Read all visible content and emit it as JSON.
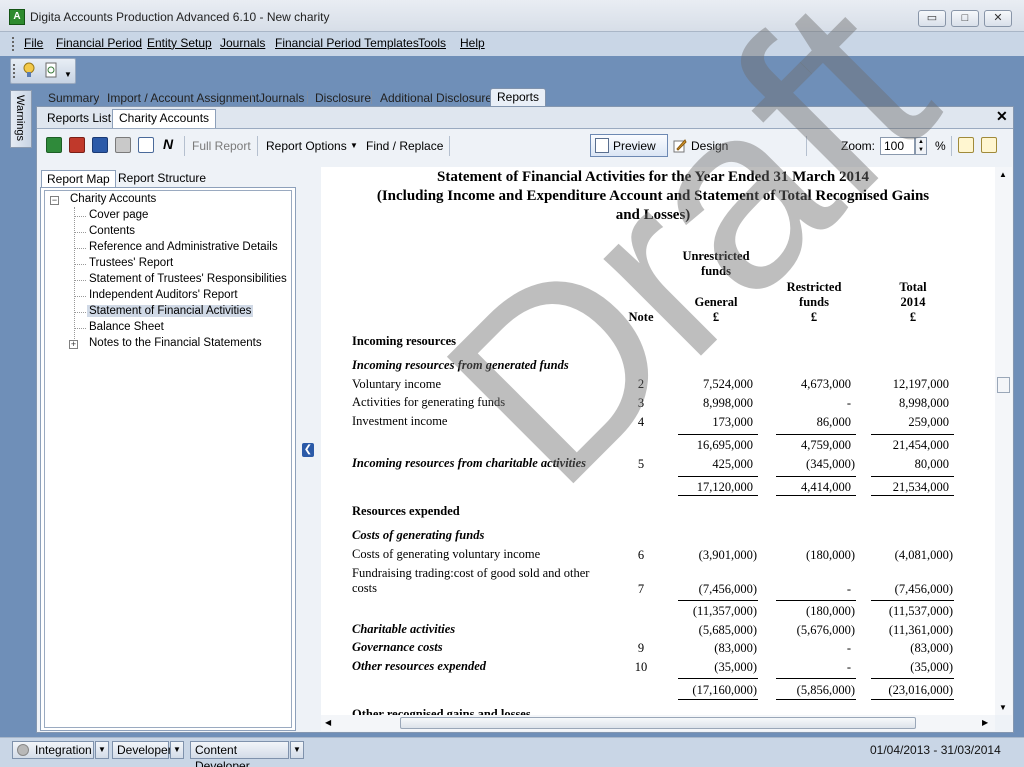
{
  "window": {
    "title": "Digita Accounts Production Advanced 6.10 - New charity",
    "app_icon": "A",
    "minimize": "▭",
    "maximize": "□",
    "close": "✕"
  },
  "menu": [
    "File",
    "Financial Period",
    "Entity Setup",
    "Journals",
    "Financial Period Templates",
    "Tools",
    "Help"
  ],
  "warnings_tab": "Warnings",
  "main_tabs": [
    "Summary",
    "Import / Account Assignment",
    "Journals",
    "Disclosure",
    "Additional Disclosures",
    "Reports"
  ],
  "sub_tabs": [
    "Reports List",
    "Charity Accounts"
  ],
  "toolbar": {
    "full_report": "Full Report",
    "report_options": "Report Options",
    "find_replace": "Find / Replace",
    "preview": "Preview",
    "design": "Design",
    "zoom_label": "Zoom:",
    "zoom_value": "100",
    "zoom_unit": "%",
    "n_label": "N"
  },
  "left_tabs": [
    "Report Map",
    "Report Structure"
  ],
  "tree": {
    "root": "Charity Accounts",
    "items": [
      "Cover page",
      "Contents",
      "Reference and Administrative Details",
      "Trustees' Report",
      "Statement of Trustees' Responsibilities",
      "Independent Auditors' Report",
      "Statement of Financial Activities",
      "Balance Sheet",
      "Notes to the Financial Statements"
    ],
    "selected": "Statement of Financial Activities"
  },
  "report": {
    "title_line1": "Statement of Financial Activities for the Year Ended 31 March 2014",
    "title_line2": "(Including Income and Expenditure Account and Statement of Total Recognised Gains",
    "title_line3": "and Losses)",
    "headers": {
      "unrestricted": "Unrestricted",
      "funds": "funds",
      "general": "General",
      "restricted": "Restricted",
      "restricted_funds": "funds",
      "total": "Total",
      "year": "2014",
      "note": "Note",
      "currency": "£"
    },
    "section_incoming": "Incoming resources",
    "sub_generated": "Incoming resources from generated funds",
    "rows_generated": [
      {
        "label": "Voluntary income",
        "note": "2",
        "general": "7,524,000",
        "restricted": "4,673,000",
        "total": "12,197,000"
      },
      {
        "label": "Activities for generating funds",
        "note": "3",
        "general": "8,998,000",
        "restricted": "-",
        "total": "8,998,000"
      },
      {
        "label": "Investment income",
        "note": "4",
        "general": "173,000",
        "restricted": "86,000",
        "total": "259,000"
      }
    ],
    "subtotal_generated": {
      "general": "16,695,000",
      "restricted": "4,759,000",
      "total": "21,454,000"
    },
    "charitable_income": {
      "label": "Incoming resources from charitable activities",
      "note": "5",
      "general": "425,000",
      "restricted": "(345,000)",
      "total": "80,000"
    },
    "total_incoming": {
      "general": "17,120,000",
      "restricted": "4,414,000",
      "total": "21,534,000"
    },
    "section_expended": "Resources expended",
    "sub_costs": "Costs of generating funds",
    "rows_costs": [
      {
        "label": "Costs of generating voluntary income",
        "note": "6",
        "general": "(3,901,000)",
        "restricted": "(180,000)",
        "total": "(4,081,000)"
      },
      {
        "label_line1": "Fundraising trading:cost of good sold and other",
        "label_line2": "costs",
        "note": "7",
        "general": "(7,456,000)",
        "restricted": "-",
        "total": "(7,456,000)"
      }
    ],
    "subtotal_costs": {
      "general": "(11,357,000)",
      "restricted": "(180,000)",
      "total": "(11,537,000)"
    },
    "rows_other": [
      {
        "label": "Charitable activities",
        "note": "",
        "general": "(5,685,000)",
        "restricted": "(5,676,000)",
        "total": "(11,361,000)"
      },
      {
        "label": "Governance costs",
        "note": "9",
        "general": "(83,000)",
        "restricted": "-",
        "total": "(83,000)"
      },
      {
        "label": "Other resources expended",
        "note": "10",
        "general": "(35,000)",
        "restricted": "-",
        "total": "(35,000)"
      }
    ],
    "total_expended": {
      "general": "(17,160,000)",
      "restricted": "(5,856,000)",
      "total": "(23,016,000)"
    },
    "next_section": "Other recognised gains and losses",
    "watermark": "Draft"
  },
  "statusbar": {
    "buttons": [
      "Integration",
      "Developer",
      "Content Developer"
    ],
    "period": "01/04/2013 - 31/03/2014"
  }
}
